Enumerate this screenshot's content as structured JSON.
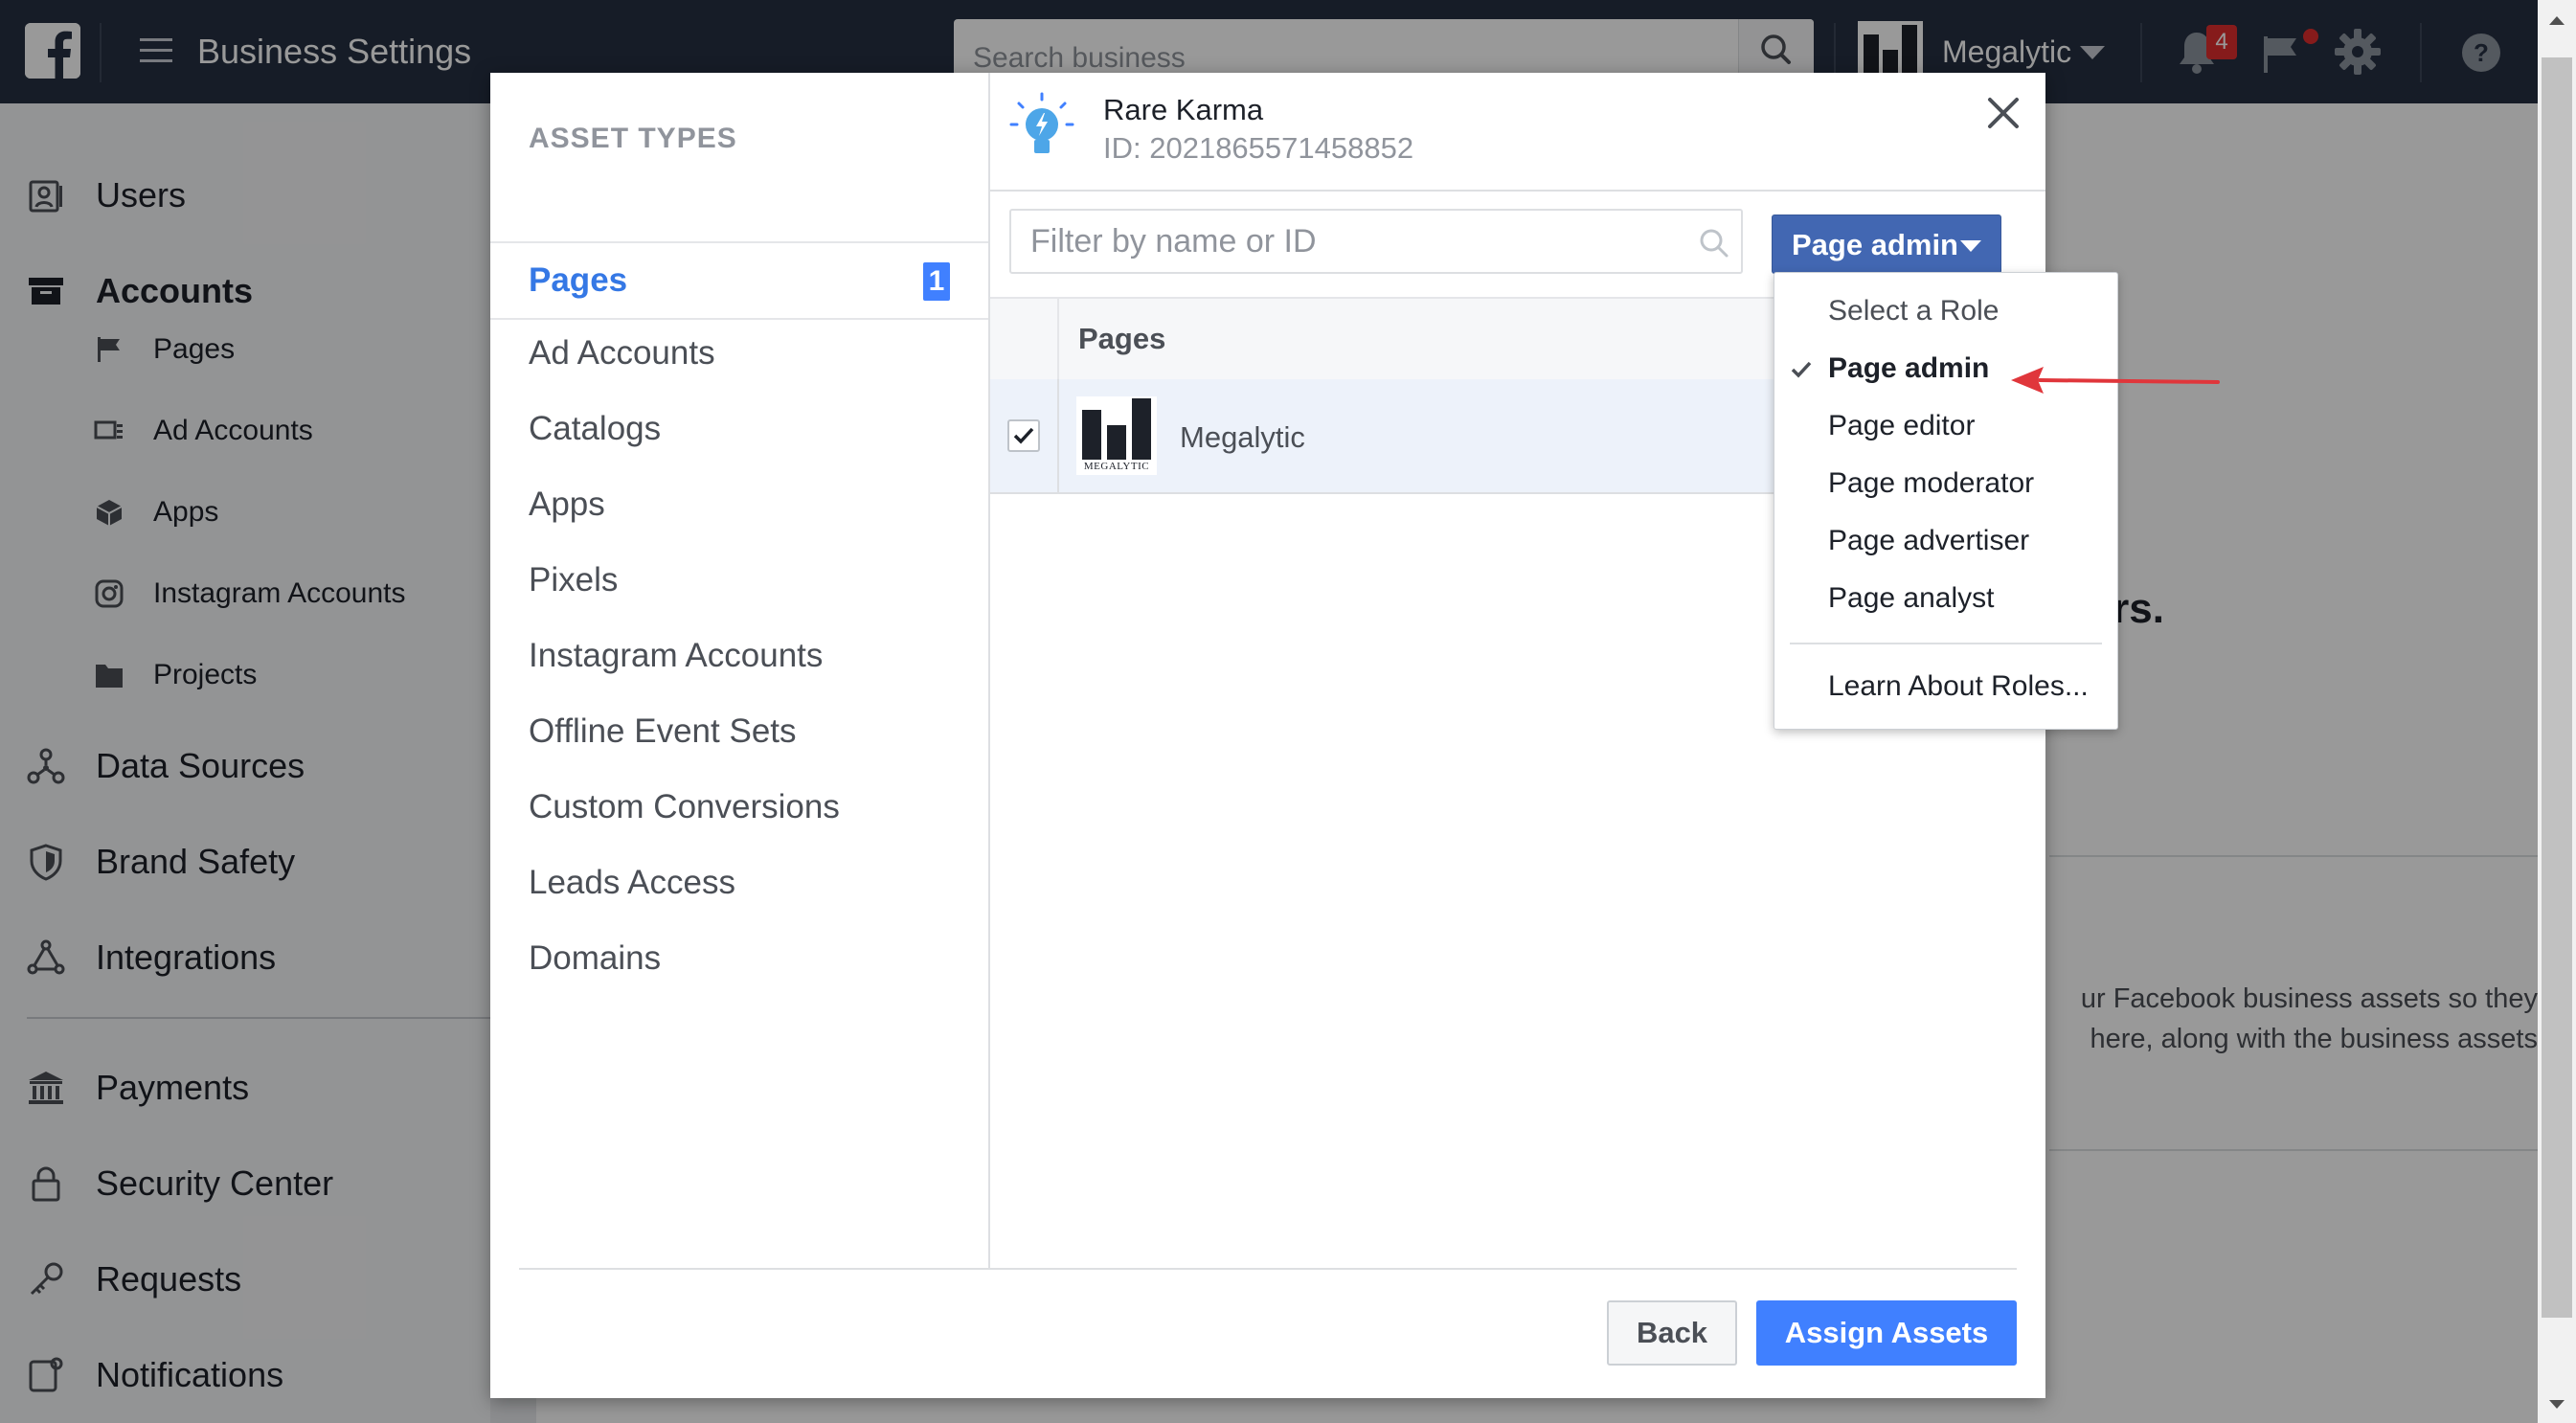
{
  "topbar": {
    "title": "Business Settings",
    "search_placeholder": "Search business",
    "account_name": "Megalytic",
    "notification_count": "4"
  },
  "sidebar": {
    "items": [
      {
        "label": "Users",
        "icon": "users-icon"
      },
      {
        "label": "Accounts",
        "icon": "accounts-icon"
      },
      {
        "label": "Pages",
        "icon": "flag-icon"
      },
      {
        "label": "Ad Accounts",
        "icon": "ad-accounts-icon"
      },
      {
        "label": "Apps",
        "icon": "cube-icon"
      },
      {
        "label": "Instagram Accounts",
        "icon": "instagram-icon"
      },
      {
        "label": "Projects",
        "icon": "folder-icon"
      },
      {
        "label": "Data Sources",
        "icon": "data-sources-icon"
      },
      {
        "label": "Brand Safety",
        "icon": "shield-icon"
      },
      {
        "label": "Integrations",
        "icon": "integrations-icon"
      },
      {
        "label": "Payments",
        "icon": "bank-icon"
      },
      {
        "label": "Security Center",
        "icon": "lock-icon"
      },
      {
        "label": "Requests",
        "icon": "key-icon"
      },
      {
        "label": "Notifications",
        "icon": "notifications-icon"
      }
    ]
  },
  "background": {
    "heading_fragment": "rs.",
    "desc_fragment": "ur Facebook business assets so they\n here, along with the business assets"
  },
  "modal": {
    "asset_types_heading": "ASSET TYPES",
    "asset_types": [
      {
        "label": "Pages",
        "count": "1",
        "active": true
      },
      {
        "label": "Ad Accounts"
      },
      {
        "label": "Catalogs"
      },
      {
        "label": "Apps"
      },
      {
        "label": "Pixels"
      },
      {
        "label": "Instagram Accounts"
      },
      {
        "label": "Offline Event Sets"
      },
      {
        "label": "Custom Conversions"
      },
      {
        "label": "Leads Access"
      },
      {
        "label": "Domains"
      }
    ],
    "org_name": "Rare Karma",
    "org_id": "ID: 2021865571458852",
    "filter_placeholder": "Filter by name or ID",
    "role_button_label": "Page admin",
    "table": {
      "column_header": "Pages",
      "rows": [
        {
          "name": "Megalytic",
          "logo_caption": "MEGALYTIC",
          "checked": true
        }
      ]
    },
    "back_label": "Back",
    "assign_label": "Assign Assets"
  },
  "role_dropdown": {
    "header": "Select a Role",
    "options": [
      "Page admin",
      "Page editor",
      "Page moderator",
      "Page advertiser",
      "Page analyst"
    ],
    "selected": "Page admin",
    "learn_more": "Learn About Roles..."
  },
  "colors": {
    "topbar": "#263041",
    "primary_blue": "#4080ff",
    "role_button": "#4267b2",
    "annotation_arrow": "#e0363b"
  }
}
